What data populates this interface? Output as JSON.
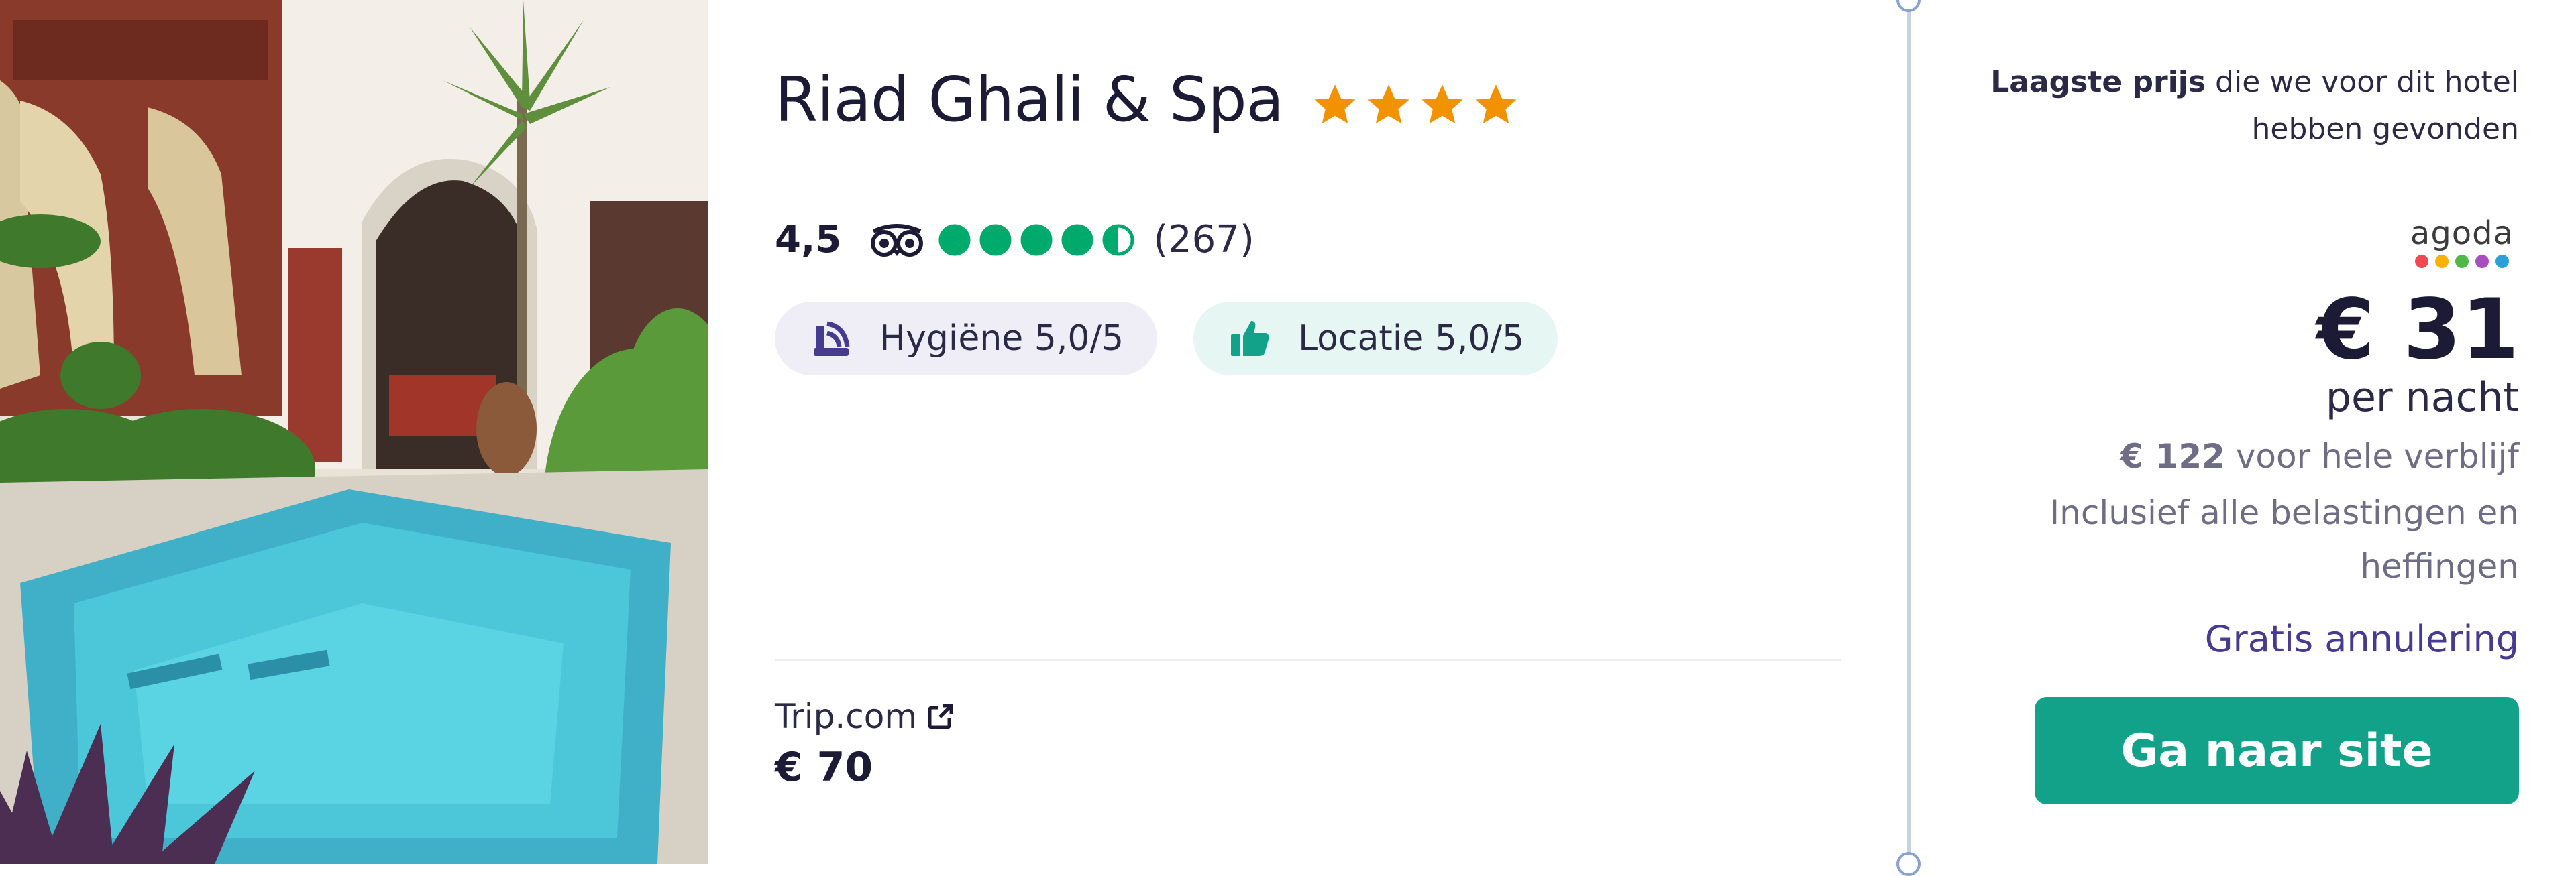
{
  "hotel": {
    "name": "Riad Ghali & Spa",
    "star_count": 4,
    "star_color": "#f39200",
    "rating_score": "4,5",
    "review_count": "(267)",
    "tripadvisor_bubbles": 4.5,
    "bubble_color": "#00aa6c",
    "photo_alt": "riad-courtyard-pool-photo"
  },
  "pills": {
    "hygiene": {
      "icon": "cleaning-icon",
      "label": "Hygiëne 5,0/5",
      "color": "#463b90"
    },
    "location": {
      "icon": "thumbs-up-icon",
      "label": "Locatie 5,0/5",
      "color": "#12a28a"
    }
  },
  "alt_offer": {
    "provider": "Trip.com",
    "provider_icon": "external-link-icon",
    "price": "€ 70"
  },
  "best_offer": {
    "lowest_bold": "Laagste prijs",
    "lowest_rest": " die we voor dit hotel hebben gevonden",
    "provider_logo": "agoda",
    "provider_dot_colors": [
      "#ef4a54",
      "#f7b300",
      "#4fb848",
      "#a94ec1",
      "#2a9fd8"
    ],
    "price": "€ 31",
    "per_night": "per nacht",
    "total_bold": "€ 122",
    "total_rest": " voor hele verblijf",
    "taxes_note": "Inclusief alle belastingen en heffingen",
    "free_cancel": "Gratis annulering",
    "cta_label": "Ga naar site",
    "cta_color": "#12a28a"
  }
}
